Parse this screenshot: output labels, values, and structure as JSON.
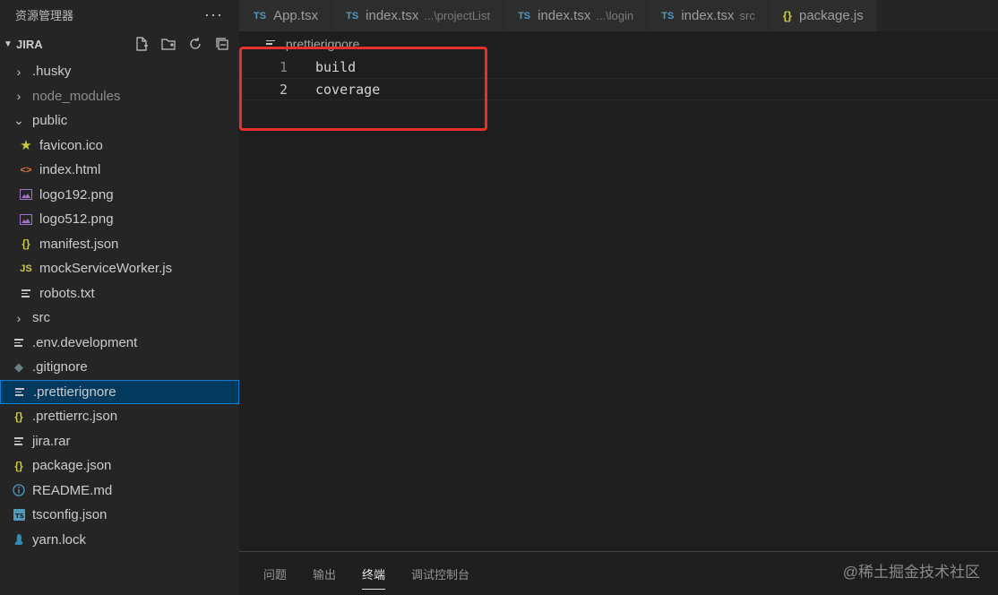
{
  "sidebar": {
    "title": "资源管理器",
    "more": "···",
    "folder": "JIRA",
    "items": [
      {
        "label": ".husky",
        "icon": "chevron-right-icon",
        "type": "folder",
        "level": 0
      },
      {
        "label": "node_modules",
        "icon": "chevron-right-icon",
        "type": "folder",
        "level": 0,
        "dim": true
      },
      {
        "label": "public",
        "icon": "chevron-down-icon",
        "type": "folder",
        "level": 0
      },
      {
        "label": "favicon.ico",
        "icon": "star-icon",
        "type": "file",
        "level": 1,
        "color": "#cbcb41"
      },
      {
        "label": "index.html",
        "icon": "html-icon",
        "type": "file",
        "level": 1,
        "color": "#e37933"
      },
      {
        "label": "logo192.png",
        "icon": "image-icon",
        "type": "file",
        "level": 1,
        "color": "#a074c4"
      },
      {
        "label": "logo512.png",
        "icon": "image-icon",
        "type": "file",
        "level": 1,
        "color": "#a074c4"
      },
      {
        "label": "manifest.json",
        "icon": "json-icon",
        "type": "file",
        "level": 1,
        "color": "#cbcb41"
      },
      {
        "label": "mockServiceWorker.js",
        "icon": "js-icon",
        "type": "file",
        "level": 1,
        "color": "#cbcb41"
      },
      {
        "label": "robots.txt",
        "icon": "text-file-icon",
        "type": "file",
        "level": 1
      },
      {
        "label": "src",
        "icon": "chevron-right-icon",
        "type": "folder",
        "level": 0
      },
      {
        "label": ".env.development",
        "icon": "text-file-icon",
        "type": "file",
        "level": 0
      },
      {
        "label": ".gitignore",
        "icon": "git-icon",
        "type": "file",
        "level": 0,
        "color": "#41535b"
      },
      {
        "label": ".prettierignore",
        "icon": "text-file-icon",
        "type": "file",
        "level": 0,
        "selected": true
      },
      {
        "label": ".prettierrc.json",
        "icon": "json-icon",
        "type": "file",
        "level": 0,
        "color": "#cbcb41"
      },
      {
        "label": "jira.rar",
        "icon": "text-file-icon",
        "type": "file",
        "level": 0
      },
      {
        "label": "package.json",
        "icon": "json-icon",
        "type": "file",
        "level": 0,
        "color": "#cbcb41"
      },
      {
        "label": "README.md",
        "icon": "info-icon",
        "type": "file",
        "level": 0,
        "color": "#519aba"
      },
      {
        "label": "tsconfig.json",
        "icon": "tsconfig-icon",
        "type": "file",
        "level": 0,
        "color": "#519aba"
      },
      {
        "label": "yarn.lock",
        "icon": "yarn-icon",
        "type": "file",
        "level": 0,
        "color": "#2c8ebb"
      }
    ]
  },
  "tabs": [
    {
      "icon": "TS",
      "label": "App.tsx",
      "desc": ""
    },
    {
      "icon": "TS",
      "label": "index.tsx",
      "desc": "...\\projectList"
    },
    {
      "icon": "TS",
      "label": "index.tsx",
      "desc": "...\\login"
    },
    {
      "icon": "TS",
      "label": "index.tsx",
      "desc": "src"
    },
    {
      "icon": "{}",
      "label": "package.js",
      "desc": ""
    }
  ],
  "editor": {
    "breadcrumb": ".prettierignore",
    "lines": [
      {
        "num": "1",
        "text": "build"
      },
      {
        "num": "2",
        "text": "coverage"
      }
    ]
  },
  "panel": {
    "tabs": [
      "问题",
      "输出",
      "终端",
      "调试控制台"
    ],
    "active": "终端"
  },
  "watermark": "@稀土掘金技术社区",
  "colors": {
    "highlight": "#e8302a",
    "selection": "#04395e",
    "ts_icon": "#519aba"
  }
}
